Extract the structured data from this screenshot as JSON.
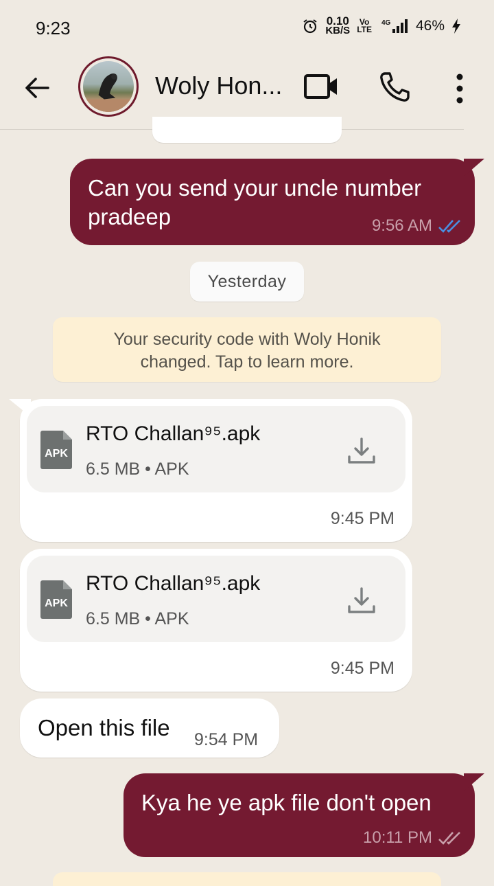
{
  "status_bar": {
    "time": "9:23",
    "speed_value": "0.10",
    "speed_unit": "KB/S",
    "volte_top": "Vo",
    "volte_bottom": "LTE",
    "network": "4G",
    "battery": "46%"
  },
  "header": {
    "contact_name": "Woly Hon...",
    "icons": [
      "back-arrow-icon",
      "video-call-icon",
      "phone-icon",
      "more-vert-icon"
    ]
  },
  "messages": {
    "out1": {
      "line1": "Can you send your uncle number",
      "line2": "pradeep",
      "time": "9:56 AM",
      "ticks_color": "#4a90e2"
    },
    "date_chip": "Yesterday",
    "security_notice_line1": "Your security code with Woly Honik",
    "security_notice_line2": "changed. Tap to learn more.",
    "file1": {
      "icon_label": "APK",
      "name": "RTO Challan⁹⁵.apk",
      "meta": "6.5 MB • APK",
      "time": "9:45 PM"
    },
    "file2": {
      "icon_label": "APK",
      "name": "RTO Challan⁹⁵.apk",
      "meta": "6.5 MB • APK",
      "time": "9:45 PM"
    },
    "in_text": {
      "text": "Open this file",
      "time": "9:54 PM"
    },
    "out2": {
      "text": "Kya he ye apk file don't open",
      "time": "10:11 PM",
      "ticks_color": "#c9a0ab"
    }
  },
  "colors": {
    "background": "#efeae2",
    "outgoing_bubble": "#741a31",
    "incoming_bubble": "#ffffff",
    "security_notice": "#fdf0d4"
  }
}
